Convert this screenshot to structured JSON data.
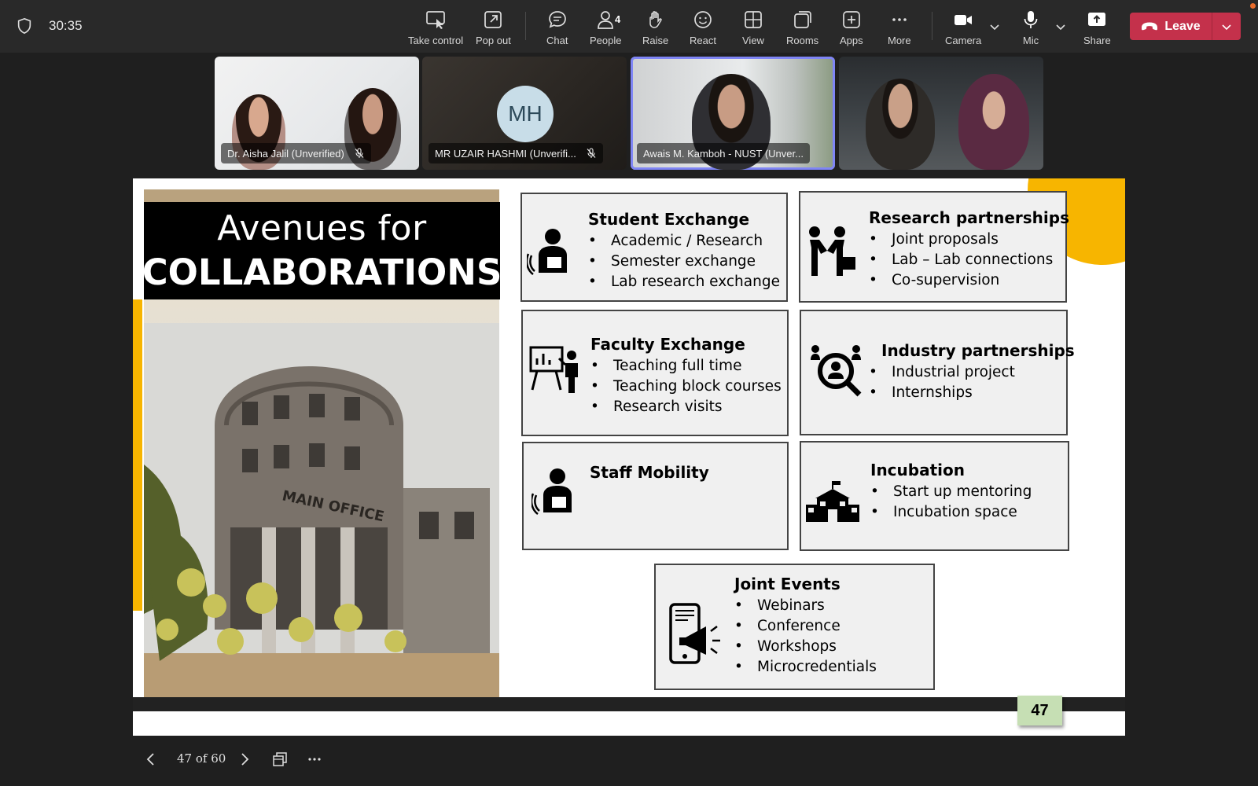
{
  "meeting": {
    "timer": "30:35",
    "toolbar": {
      "take_control": "Take control",
      "pop_out": "Pop out",
      "chat": "Chat",
      "people": "People",
      "people_count": "4",
      "raise": "Raise",
      "react": "React",
      "view": "View",
      "rooms": "Rooms",
      "apps": "Apps",
      "more": "More",
      "camera": "Camera",
      "mic": "Mic",
      "share": "Share",
      "leave": "Leave"
    },
    "accent_color": "#7f85f5",
    "leave_color": "#c4314b"
  },
  "participants": [
    {
      "name": "Dr. Aisha Jalil (Unverified)",
      "muted": true
    },
    {
      "name": "MR UZAIR HASHMI (Unverifi...",
      "initials": "MH",
      "muted": true
    },
    {
      "name": "Awais M. Kamboh - NUST (Unver...",
      "active_speaker": true
    },
    {
      "name": ""
    }
  ],
  "slide": {
    "title_line1": "Avenues for",
    "title_line2": "COLLABORATIONS",
    "photo_sign": "MAIN OFFICE",
    "slide_number": "47",
    "cards": {
      "student_exchange": {
        "title": "Student Exchange",
        "items": [
          "Academic / Research",
          "Semester exchange",
          "Lab research exchange"
        ]
      },
      "research_partnerships": {
        "title": "Research partnerships",
        "items": [
          "Joint proposals",
          "Lab – Lab connections",
          "Co-supervision"
        ]
      },
      "faculty_exchange": {
        "title": "Faculty Exchange",
        "items": [
          "Teaching full time",
          "Teaching block courses",
          "Research visits"
        ]
      },
      "industry_partnerships": {
        "title": "Industry partnerships",
        "items": [
          "Industrial project",
          "Internships"
        ]
      },
      "staff_mobility": {
        "title": "Staff Mobility"
      },
      "incubation": {
        "title": "Incubation",
        "items": [
          "Start up mentoring",
          "Incubation space"
        ]
      },
      "joint_events": {
        "title": "Joint Events",
        "items": [
          "Webinars",
          "Conference",
          "Workshops",
          "Microcredentials"
        ]
      }
    },
    "accent_color": "#f7b500"
  },
  "navigation": {
    "page_indicator": "47 of 60"
  }
}
